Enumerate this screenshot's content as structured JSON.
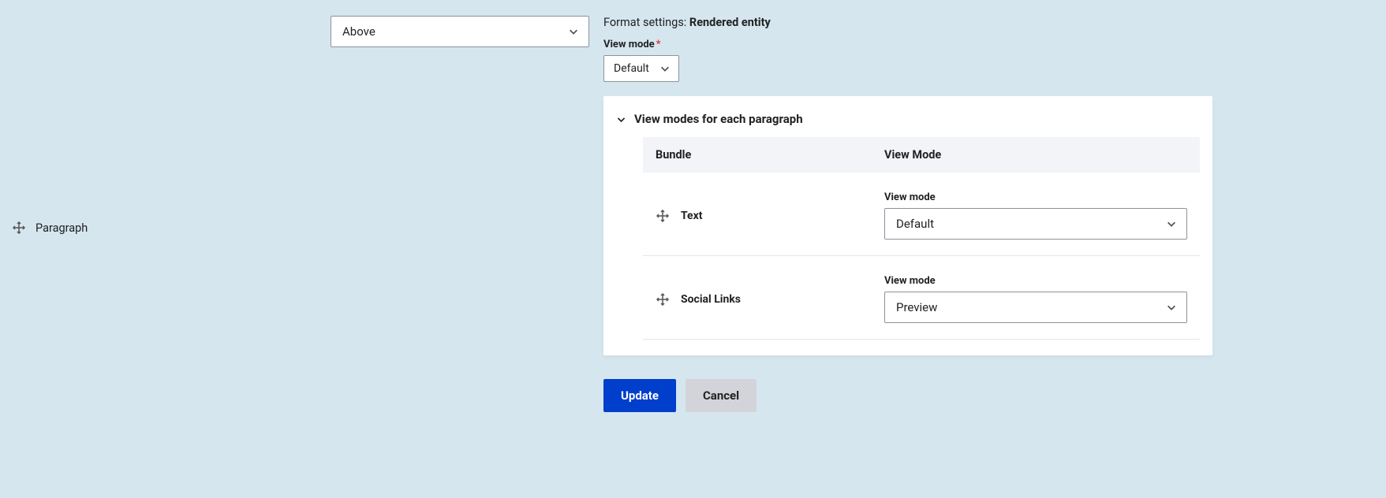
{
  "field": {
    "name": "Paragraph"
  },
  "label_select": {
    "value": "Above"
  },
  "format": {
    "prefix": "Format settings: ",
    "name": "Rendered entity"
  },
  "view_mode": {
    "label": "View mode",
    "required_marker": "*",
    "value": "Default"
  },
  "details": {
    "title": "View modes for each paragraph",
    "columns": {
      "bundle": "Bundle",
      "viewmode": "View Mode"
    },
    "rows": {
      "0": {
        "bundle": "Text",
        "vm_label": "View mode",
        "vm_value": "Default"
      },
      "1": {
        "bundle": "Social Links",
        "vm_label": "View mode",
        "vm_value": "Preview"
      }
    }
  },
  "actions": {
    "update": "Update",
    "cancel": "Cancel"
  }
}
